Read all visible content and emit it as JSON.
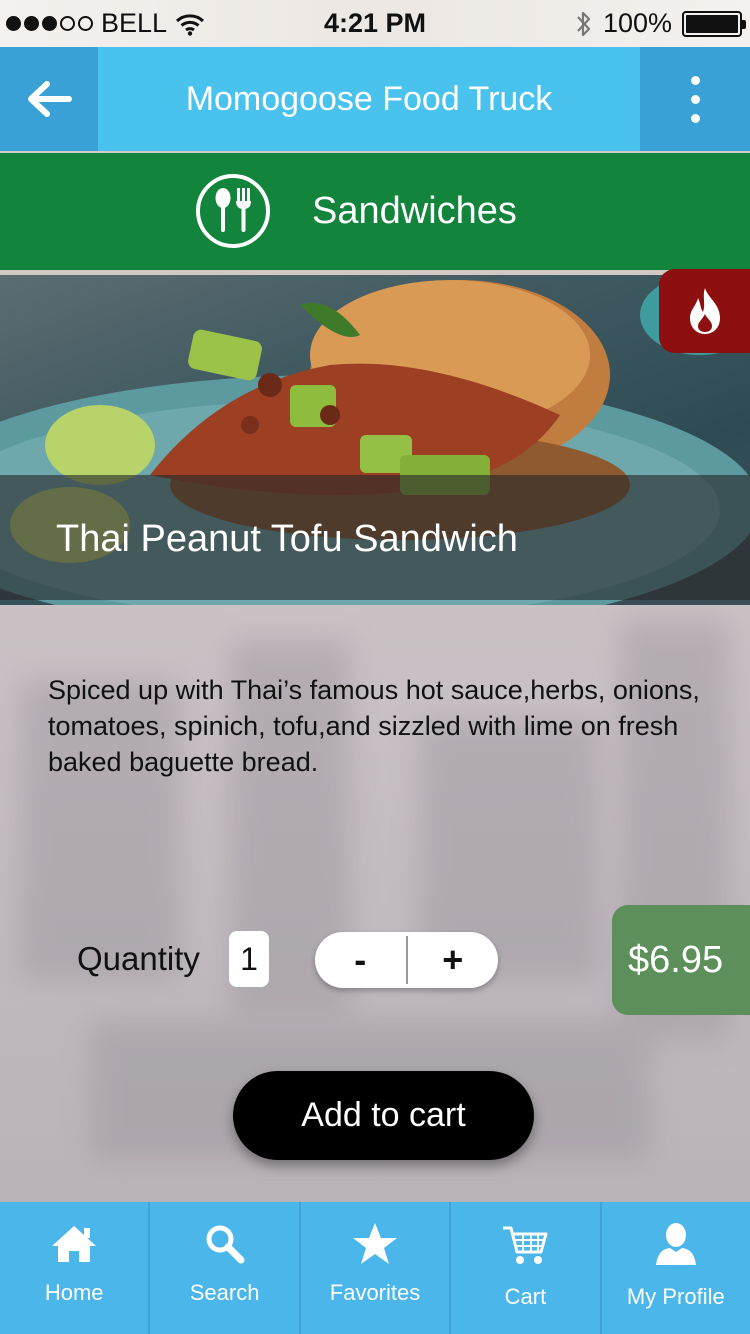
{
  "status_bar": {
    "carrier": "BELL",
    "time": "4:21 PM",
    "battery": "100%",
    "signal_bars_filled": 3,
    "signal_bars_total": 5
  },
  "header": {
    "title": "Momogoose Food Truck",
    "back_icon": "arrow-left-icon",
    "menu_icon": "kebab-menu-icon"
  },
  "category": {
    "label": "Sandwiches",
    "icon": "utensils-icon"
  },
  "item": {
    "name": "Thai Peanut Tofu Sandwich",
    "hot_badge_icon": "flame-icon",
    "description": "Spiced up with Thai’s famous hot sauce,herbs, onions, tomatoes, spinich, tofu,and sizzled with lime on fresh baked baguette bread.",
    "price": "$6.95"
  },
  "order": {
    "quantity_label": "Quantity",
    "quantity": "1",
    "decrement_label": "-",
    "increment_label": "+",
    "add_to_cart_label": "Add to cart"
  },
  "tabs": [
    {
      "label": "Home",
      "icon": "home-icon"
    },
    {
      "label": "Search",
      "icon": "search-icon"
    },
    {
      "label": "Favorites",
      "icon": "star-icon"
    },
    {
      "label": "Cart",
      "icon": "cart-icon"
    },
    {
      "label": "My Profile",
      "icon": "user-icon"
    }
  ],
  "colors": {
    "nav_blue": "#4ac2ee",
    "nav_button_blue": "#3aa1d6",
    "category_green": "#12843b",
    "hot_red": "#8e0f0f",
    "price_green": "#5c8f5a",
    "tab_blue": "#4ab6ea"
  }
}
